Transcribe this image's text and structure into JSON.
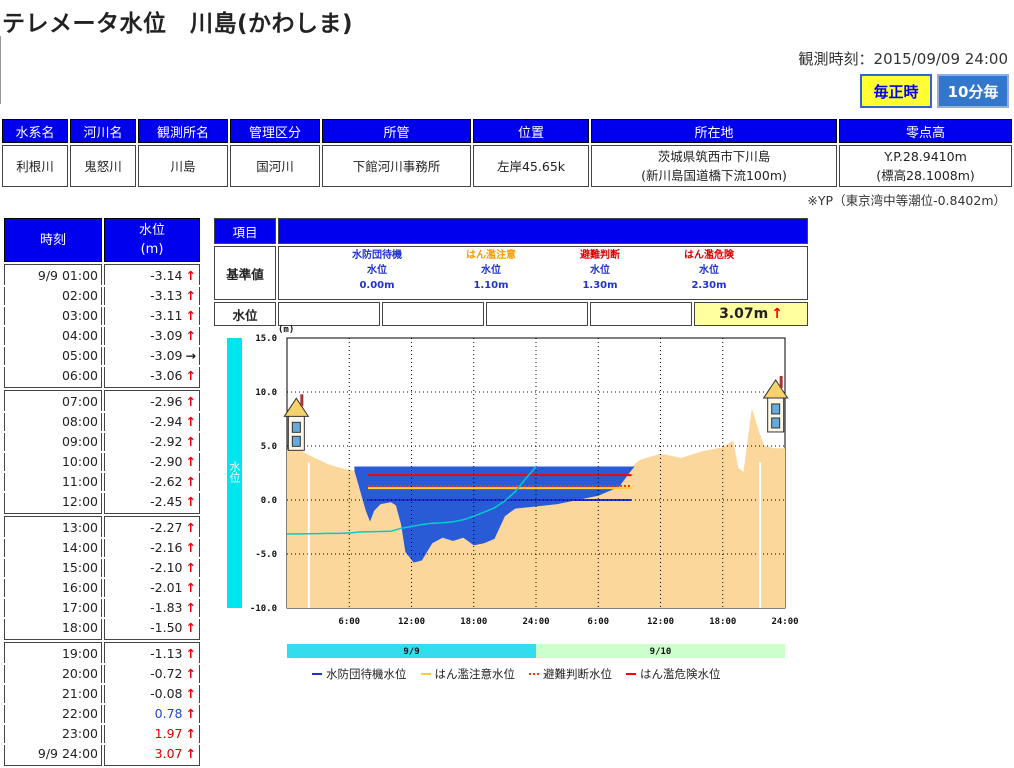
{
  "page": {
    "title": "テレメータ水位　川島(かわしま)",
    "obs_time": "観測時刻：2015/09/09 24:00",
    "buttons": {
      "hourly": "毎正時",
      "tenmin": "10分毎"
    }
  },
  "station_info": {
    "headers": [
      "水系名",
      "河川名",
      "観測所名",
      "管理区分",
      "所管",
      "位置",
      "所在地",
      "零点高"
    ],
    "values": [
      "利根川",
      "鬼怒川",
      "川島",
      "国河川",
      "下館河川事務所",
      "左岸45.65k",
      "茨城県筑西市下川島",
      "Y.P.28.9410m"
    ],
    "values_line2": [
      "",
      "",
      "",
      "",
      "",
      "",
      "(新川島国道橋下流100m)",
      "(標高28.1008m)"
    ],
    "yp_note": "※YP（東京湾中等潮位-0.8402m）"
  },
  "timeseries": {
    "header_time": "時刻",
    "header_level": "水位",
    "header_unit": "(m)",
    "rows": [
      {
        "time": "9/9 01:00",
        "value": "-3.14",
        "arrow": "↑",
        "color": "#222"
      },
      {
        "time": "02:00",
        "value": "-3.13",
        "arrow": "↑",
        "color": "#222"
      },
      {
        "time": "03:00",
        "value": "-3.11",
        "arrow": "↑",
        "color": "#222"
      },
      {
        "time": "04:00",
        "value": "-3.09",
        "arrow": "↑",
        "color": "#222"
      },
      {
        "time": "05:00",
        "value": "-3.09",
        "arrow": "→",
        "color": "#222"
      },
      {
        "time": "06:00",
        "value": "-3.06",
        "arrow": "↑",
        "color": "#222"
      },
      {
        "time": "07:00",
        "value": "-2.96",
        "arrow": "↑",
        "color": "#222"
      },
      {
        "time": "08:00",
        "value": "-2.94",
        "arrow": "↑",
        "color": "#222"
      },
      {
        "time": "09:00",
        "value": "-2.92",
        "arrow": "↑",
        "color": "#222"
      },
      {
        "time": "10:00",
        "value": "-2.90",
        "arrow": "↑",
        "color": "#222"
      },
      {
        "time": "11:00",
        "value": "-2.62",
        "arrow": "↑",
        "color": "#222"
      },
      {
        "time": "12:00",
        "value": "-2.45",
        "arrow": "↑",
        "color": "#222"
      },
      {
        "time": "13:00",
        "value": "-2.27",
        "arrow": "↑",
        "color": "#222"
      },
      {
        "time": "14:00",
        "value": "-2.16",
        "arrow": "↑",
        "color": "#222"
      },
      {
        "time": "15:00",
        "value": "-2.10",
        "arrow": "↑",
        "color": "#222"
      },
      {
        "time": "16:00",
        "value": "-2.01",
        "arrow": "↑",
        "color": "#222"
      },
      {
        "time": "17:00",
        "value": "-1.83",
        "arrow": "↑",
        "color": "#222"
      },
      {
        "time": "18:00",
        "value": "-1.50",
        "arrow": "↑",
        "color": "#222"
      },
      {
        "time": "19:00",
        "value": "-1.13",
        "arrow": "↑",
        "color": "#222"
      },
      {
        "time": "20:00",
        "value": "-0.72",
        "arrow": "↑",
        "color": "#222"
      },
      {
        "time": "21:00",
        "value": "-0.08",
        "arrow": "↑",
        "color": "#222"
      },
      {
        "time": "22:00",
        "value": "0.78",
        "arrow": "↑",
        "color": "#2244cc"
      },
      {
        "time": "23:00",
        "value": "1.97",
        "arrow": "↑",
        "color": "#dd0000"
      },
      {
        "time": "9/9 24:00",
        "value": "3.07",
        "arrow": "↑",
        "color": "#dd0000"
      }
    ]
  },
  "levels": {
    "header": "項目",
    "std_label": "基準値",
    "level_label": "水位",
    "thresholds": [
      {
        "name": "水防団待機",
        "sub": "水位",
        "value": "0.00m",
        "color": "#2233cc"
      },
      {
        "name": "はん濫注意",
        "sub": "水位",
        "value": "1.10m",
        "color": "#ff9900"
      },
      {
        "name": "避難判断",
        "sub": "水位",
        "value": "1.30m",
        "color": "#dd0000"
      },
      {
        "name": "はん濫危険",
        "sub": "水位",
        "value": "2.30m",
        "color": "#dd0000"
      }
    ],
    "current": "3.07m",
    "current_arrow": "↑"
  },
  "chart_data": {
    "type": "line",
    "ylabel": "水位",
    "yunit": "(m)",
    "ylim": [
      -10,
      15
    ],
    "yticks": [
      "15.0",
      "10.0",
      "5.0",
      "0.0",
      "-5.0",
      "-10.0"
    ],
    "xticks": [
      "6:00",
      "12:00",
      "18:00",
      "24:00",
      "6:00",
      "12:00",
      "18:00",
      "24:00"
    ],
    "date_labels": [
      "9/9",
      "9/10"
    ],
    "grid": true,
    "series": [
      {
        "name": "水防団待機水位",
        "color": "#2233cc",
        "value": 0.0
      },
      {
        "name": "はん濫注意水位",
        "color": "#ffcc33",
        "value": 1.1
      },
      {
        "name": "避難判断水位",
        "color": "#ff3300",
        "value": 1.3
      },
      {
        "name": "はん濫危険水位",
        "color": "#ff0000",
        "value": 2.3
      }
    ],
    "water_level": {
      "x_hours": [
        1,
        2,
        3,
        4,
        5,
        6,
        7,
        8,
        9,
        10,
        11,
        12,
        13,
        14,
        15,
        16,
        17,
        18,
        19,
        20,
        21,
        22,
        23,
        24
      ],
      "y": [
        -3.14,
        -3.13,
        -3.11,
        -3.09,
        -3.09,
        -3.06,
        -2.96,
        -2.94,
        -2.92,
        -2.9,
        -2.62,
        -2.45,
        -2.27,
        -2.16,
        -2.1,
        -2.01,
        -1.83,
        -1.5,
        -1.13,
        -0.72,
        -0.08,
        0.78,
        1.97,
        3.07
      ],
      "color": "#00cccc"
    },
    "legend_position": "bottom"
  }
}
